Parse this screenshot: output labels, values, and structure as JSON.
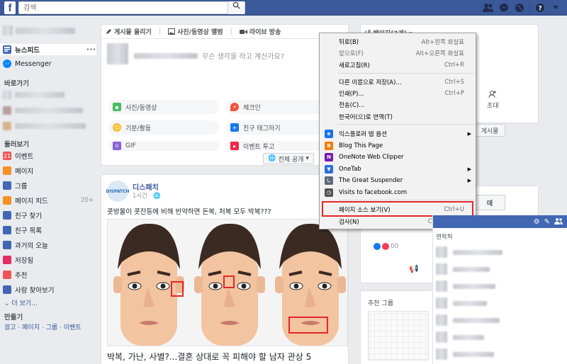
{
  "topbar": {
    "logo": "f",
    "search_placeholder": "검색"
  },
  "sidebar": {
    "items": [
      {
        "label": "뉴스피드",
        "color": "#4267b2"
      },
      {
        "label": "Messenger",
        "color": "#0084ff"
      }
    ],
    "shortcuts_title": "바로가기",
    "explore_title": "둘러보기",
    "explore": [
      {
        "label": "이벤트",
        "icon": "21",
        "color": "#f05555",
        "count": ""
      },
      {
        "label": "페이지",
        "icon": "",
        "color": "#f68f25",
        "count": ""
      },
      {
        "label": "그룹",
        "icon": "",
        "color": "#4267b2",
        "count": ""
      },
      {
        "label": "페이지 피드",
        "icon": "",
        "color": "#f68f25",
        "count": "20+"
      },
      {
        "label": "친구 찾기",
        "icon": "",
        "color": "#4267b2",
        "count": ""
      },
      {
        "label": "친구 목록",
        "icon": "",
        "color": "#4267b2",
        "count": ""
      },
      {
        "label": "과거의 오늘",
        "icon": "",
        "color": "#4267b2",
        "count": ""
      },
      {
        "label": "저장됨",
        "icon": "",
        "color": "#e42d64",
        "count": ""
      },
      {
        "label": "추천",
        "icon": "",
        "color": "#f05555",
        "count": ""
      },
      {
        "label": "사람 찾아보기",
        "icon": "",
        "color": "#4267b2",
        "count": ""
      }
    ],
    "more": "더 보기...",
    "create_title": "만들기",
    "create_links": "광고 · 페이지 · 그룹 · 이벤트"
  },
  "composer": {
    "tabs": [
      "게시물 올리기",
      "사진/동영상 앨범",
      "라이브 방송"
    ],
    "prompt": "무슨 생각을 하고 계신가요?",
    "buttons": [
      "사진/동영상",
      "체크인",
      "기분/활동",
      "친구 태그하기",
      "GIF",
      "이벤트 투고"
    ],
    "share": "전체 공개"
  },
  "post": {
    "page_name": "디스패치",
    "avatar_text": "DISPATCH",
    "time": "1시간 · 🌐",
    "text": "콧방울이 콧잔등에 비해 빈약하면 돈복, 처복 모두 박복???",
    "title": "박복, 가난, 사별?...결혼 상대로 꼭 피해야 할 남자 관상 5"
  },
  "right": {
    "pages_header": "내 페이지(2개) ▾",
    "invite": "초대",
    "post_btn": "게시물",
    "ad_btn": "데",
    "reactions": "00",
    "recommended_groups": "추천 그룹"
  },
  "menu": {
    "items": [
      {
        "label": "뒤로(B)",
        "shortcut": "Alt+왼쪽 화살표"
      },
      {
        "label": "앞으로(F)",
        "shortcut": "Alt+오른쪽 화살표",
        "disabled": true
      },
      {
        "label": "새로고침(R)",
        "shortcut": "Ctrl+R"
      },
      {
        "label": "다른 이름으로 저장(A)...",
        "shortcut": "Ctrl+S"
      },
      {
        "label": "인쇄(P)...",
        "shortcut": "Ctrl+P"
      },
      {
        "label": "전송(C)...",
        "shortcut": ""
      },
      {
        "label": "한국어(으)로 번역(T)",
        "shortcut": ""
      },
      {
        "label": "익스플로러 탭 옵션",
        "shortcut": "",
        "submenu": true,
        "icon": "e",
        "icon_color": "#1a73e8"
      },
      {
        "label": "Blog This Page",
        "shortcut": "",
        "icon": "B",
        "icon_color": "#f57d00"
      },
      {
        "label": "OneNote Web Clipper",
        "shortcut": "",
        "icon": "N",
        "icon_color": "#7719aa"
      },
      {
        "label": "OneTab",
        "shortcut": "",
        "submenu": true,
        "icon": "▼",
        "icon_color": "#2a6fdb"
      },
      {
        "label": "The Great Suspender",
        "shortcut": "",
        "submenu": true,
        "icon": "⏾",
        "icon_color": "#5b6a7a"
      },
      {
        "label": "Visits to facebook.com",
        "shortcut": "",
        "icon": "◷",
        "icon_color": "#555555"
      },
      {
        "label": "페이지 소스 보기(V)",
        "shortcut": "Ctrl+U"
      },
      {
        "label": "검사(N)",
        "shortcut": "Ctrl+Shift+I"
      }
    ],
    "highlight_color": "#e52727"
  },
  "chat": {
    "title": "연락처"
  }
}
